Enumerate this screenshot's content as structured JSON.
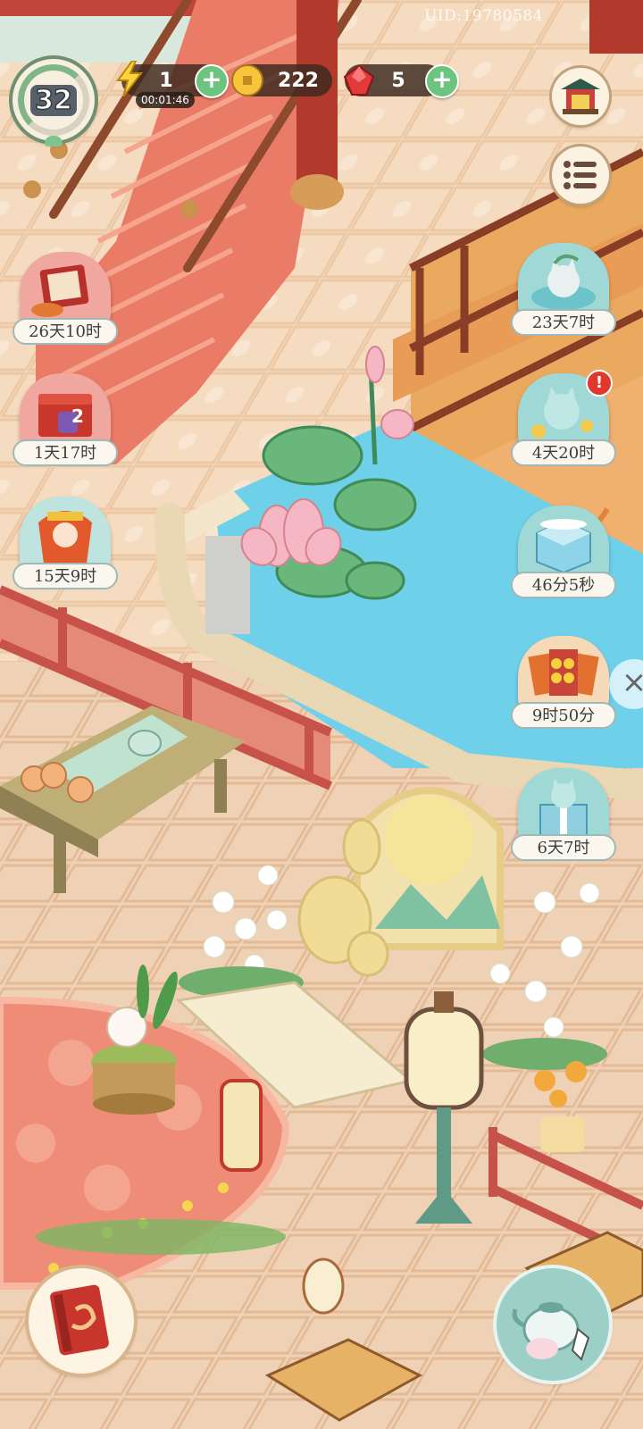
{
  "hud": {
    "uid": "UID:19780584",
    "level": "32",
    "energy": "1",
    "energy_timer": "00:01:46",
    "coins": "222",
    "gems": "5"
  },
  "icons": {
    "energy": "lightning-icon",
    "coin": "coin-icon",
    "gem": "red-gem-icon",
    "plus": "+",
    "shop": "pavilion-shop-icon",
    "menu": "list-menu-icon",
    "close": "×"
  },
  "events_left": [
    {
      "name": "scroll-festival-event",
      "timer": "26天10时"
    },
    {
      "name": "gift-box-event",
      "timer": "1天17时",
      "badge": "2"
    },
    {
      "name": "autumn-bride-event",
      "timer": "15天9时"
    }
  ],
  "events_right": [
    {
      "name": "bath-cat-event",
      "timer": "23天7时"
    },
    {
      "name": "moon-cat-event",
      "timer": "4天20时",
      "alert": "!"
    },
    {
      "name": "ice-block-event",
      "timer": "46分5秒"
    },
    {
      "name": "coin-cards-event",
      "timer": "9时50分"
    },
    {
      "name": "gift-cat-event",
      "timer": "6天7时"
    }
  ],
  "colors": {
    "accent_green": "#6dc47f",
    "bubble_border": "#9fb8b8",
    "floor": "#f3d9bb",
    "stairs": "#e87a66",
    "pond": "#6fd0ea",
    "rug": "#ee8c78"
  }
}
